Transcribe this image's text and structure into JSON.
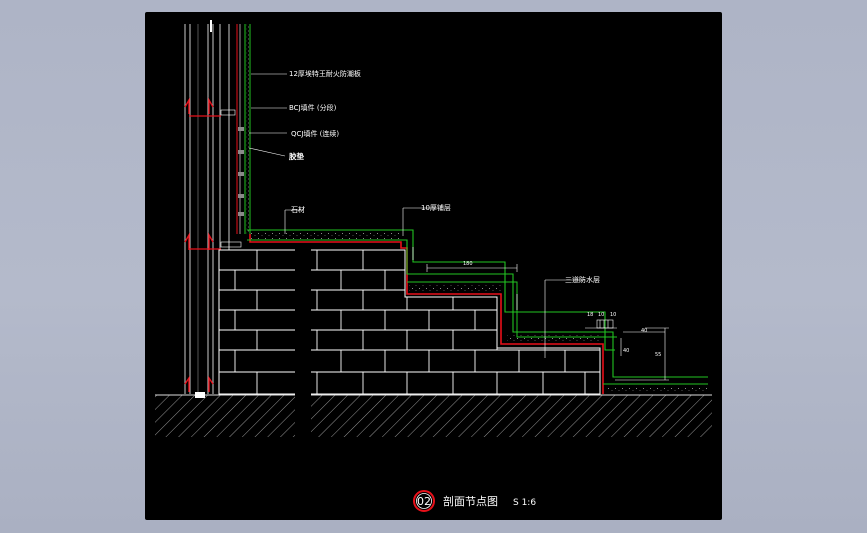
{
  "drawing": {
    "title": "剖面节点图",
    "scale": "S 1:6",
    "tag": "02",
    "labels": {
      "board": "12厚埃特王耐火防潮板",
      "bcj": "BCJ填件 (分段)",
      "qcj": "QCJ填件 (连续)",
      "glue": "胶垫",
      "stone": "石材",
      "tile": "10厚铺层",
      "waterproof": "三道防水层"
    },
    "dims": {
      "step_depth": "180",
      "d1": "18",
      "d2": "10",
      "d3": "10",
      "d4": "40",
      "d5": "40",
      "height": "55"
    }
  },
  "colors": {
    "canvas": "#000000",
    "green": "#22c322",
    "red": "#e8101a",
    "white": "#ffffff",
    "yellow": "#d6d200",
    "grey": "#8a8a8a"
  }
}
